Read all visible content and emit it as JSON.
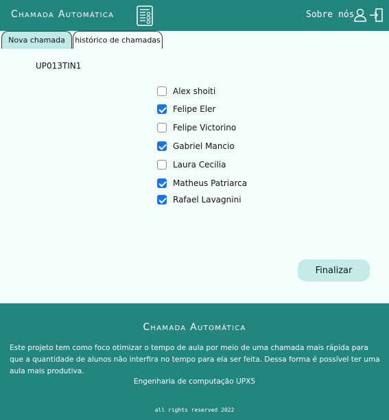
{
  "header": {
    "brand": "Chamada Automática",
    "brand_icon": "checklist-icon",
    "about_label": "Sobre nós",
    "user_icon": "user-icon",
    "logout_icon": "logout-icon"
  },
  "tabs": [
    {
      "label": "Nova chamada",
      "active": true
    },
    {
      "label": "histórico de chamadas",
      "active": false
    }
  ],
  "class_code": "UP013TIN1",
  "students": [
    {
      "name": "Alex shoiti",
      "present": false
    },
    {
      "name": "Felipe Eler",
      "present": true
    },
    {
      "name": "Felipe Victorino",
      "present": false
    },
    {
      "name": "Gabriel Mancio",
      "present": true
    },
    {
      "name": "Laura Cecilia",
      "present": false
    },
    {
      "name": "Matheus Patriarca",
      "present": true
    },
    {
      "name": "Rafael Lavagnini",
      "present": true
    }
  ],
  "finish_label": "Finalizar",
  "footer": {
    "brand": "Chamada Automática",
    "description": "Este projeto tem como foco otimizar o tempo de aula por meio de uma chamada mais rápida para que a quantidade de alunos não interfira no tempo para ela ser feita. Dessa forma é possível ter uma aula mais produtiva.",
    "course": "Engenharia de computação UPX5",
    "rights": "all rights reserved 2022"
  },
  "colors": {
    "primary": "#22857e",
    "tab_active": "#bfe9e6",
    "button": "#c4ebe8",
    "checkbox_checked": "#1a73e8",
    "background": "#f3fdfb"
  }
}
